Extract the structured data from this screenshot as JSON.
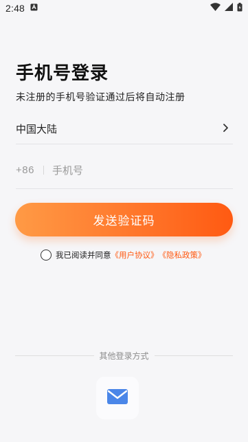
{
  "status_bar": {
    "time": "2:48"
  },
  "login": {
    "title": "手机号登录",
    "subtitle": "未注册的手机号验证通过后将自动注册",
    "region": "中国大陆",
    "country_code": "+86",
    "phone_placeholder": "手机号",
    "phone_value": "",
    "send_code_label": "发送验证码"
  },
  "agreement": {
    "prefix": "我已阅读并同意",
    "user_agreement": "《用户协议》",
    "privacy_policy": "《隐私政策》",
    "checked": false
  },
  "other_login": {
    "label": "其他登录方式",
    "methods": [
      "mail-icon"
    ]
  },
  "colors": {
    "accent": "#ff5a12",
    "gradient_start": "#ff9a45",
    "mail_icon": "#4a86e8"
  }
}
